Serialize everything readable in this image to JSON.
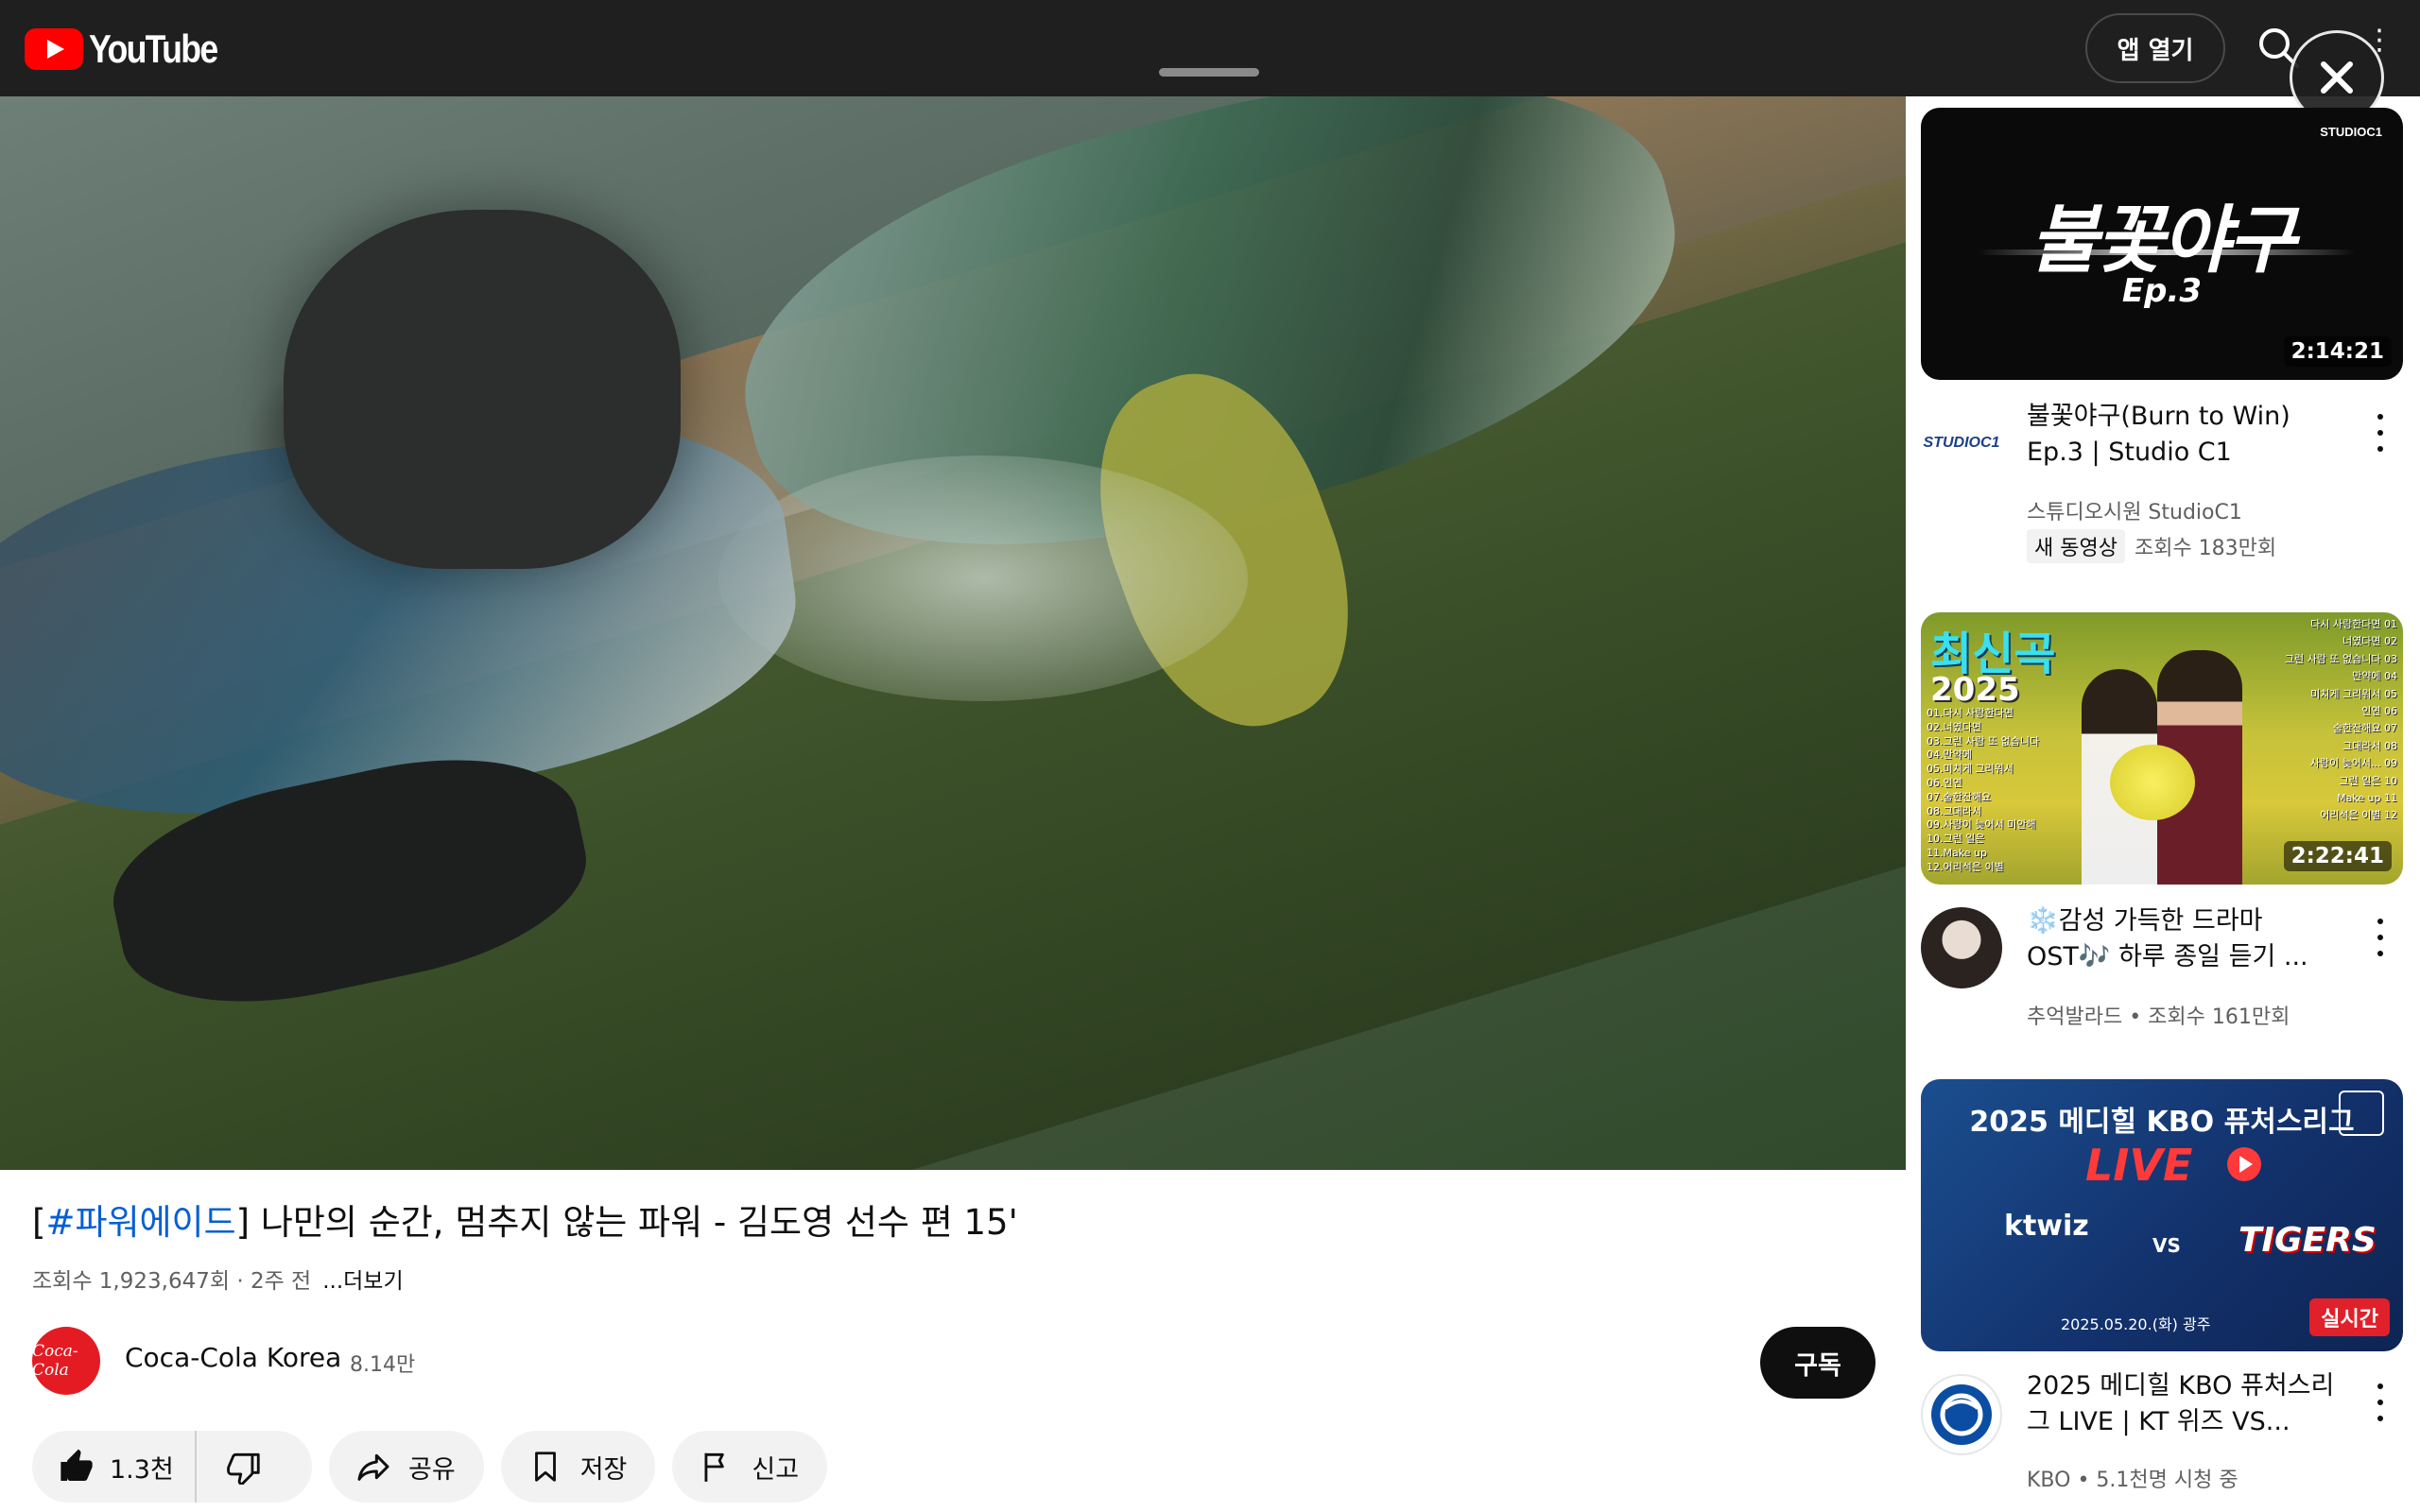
{
  "header": {
    "logo_text": "YouTube",
    "open_app_label": "앱 열기",
    "search_icon": "search-icon",
    "more_icon": "more-vert-icon",
    "close_icon": "close-icon"
  },
  "video": {
    "title_tag": "#파워에이드",
    "title_open": "[",
    "title_rest": "] 나만의 순간, 멈추지 않는 파워 - 김도영 선수 편 15'",
    "meta": "조회수 1,923,647회 · 2주 전",
    "more_label": "...더보기"
  },
  "channel": {
    "avatar_text": "Coca-Cola",
    "name": "Coca-Cola Korea",
    "subscribers": "8.14만",
    "subscribe_label": "구독"
  },
  "actions": {
    "like_count": "1.3천",
    "share_label": "공유",
    "save_label": "저장",
    "report_label": "신고"
  },
  "recommendations": [
    {
      "thumb_brand": "STUDIOC1",
      "thumb_title": "불꽃야구",
      "thumb_sub": "Ep.3",
      "duration": "2:14:21",
      "channel_avatar_text": "STUDIOC1",
      "title": "불꽃야구(Burn to Win) Ep.3 | Studio C1",
      "channel": "스튜디오시원 StudioC1",
      "badge": "새 동영상",
      "views": "조회수 183만회"
    },
    {
      "thumb_title": "최신곡",
      "thumb_year": "2025",
      "thumb_list_left": "01.다시 사랑한다면\n02.너였다면\n03.그런 사람 또 없습니다\n04.만약에\n05.미치게 그리워서\n06.인연\n07.술한잔해요\n08.그대라서\n09.사랑이 늦어서 미안해\n10.그런 일은\n11.Make up\n12.어리석은 이별",
      "thumb_list_right": "다시 사랑한다면 01\n너였다면 02\n그런 사람 또 없습니다 03\n만약에 04\n미치게 그리워서 05\n인연 06\n술한잔해요 07\n그대라서 08\n사랑이 늦어서... 09\n그런 일은 10\nMake up 11\n어리석은 이별 12",
      "duration": "2:22:41",
      "title": "❄️감성 가득한 드라마 OST🎶 하루 종일 듣기 ...",
      "meta": "추억발라드 • 조회수 161만회"
    },
    {
      "thumb_title": "2025 메디힐 KBO 퓨처스리그",
      "thumb_live": "LIVE",
      "thumb_team1": "ktwiz",
      "thumb_vs": "VS",
      "thumb_team2": "TIGERS",
      "thumb_date": "2025.05.20.(화)  광주",
      "thumb_badge": "실시간",
      "title": "2025 메디힐 KBO 퓨처스리그 LIVE | KT 위즈 VS...",
      "meta": "KBO • 5.1천명 시청 중"
    }
  ]
}
